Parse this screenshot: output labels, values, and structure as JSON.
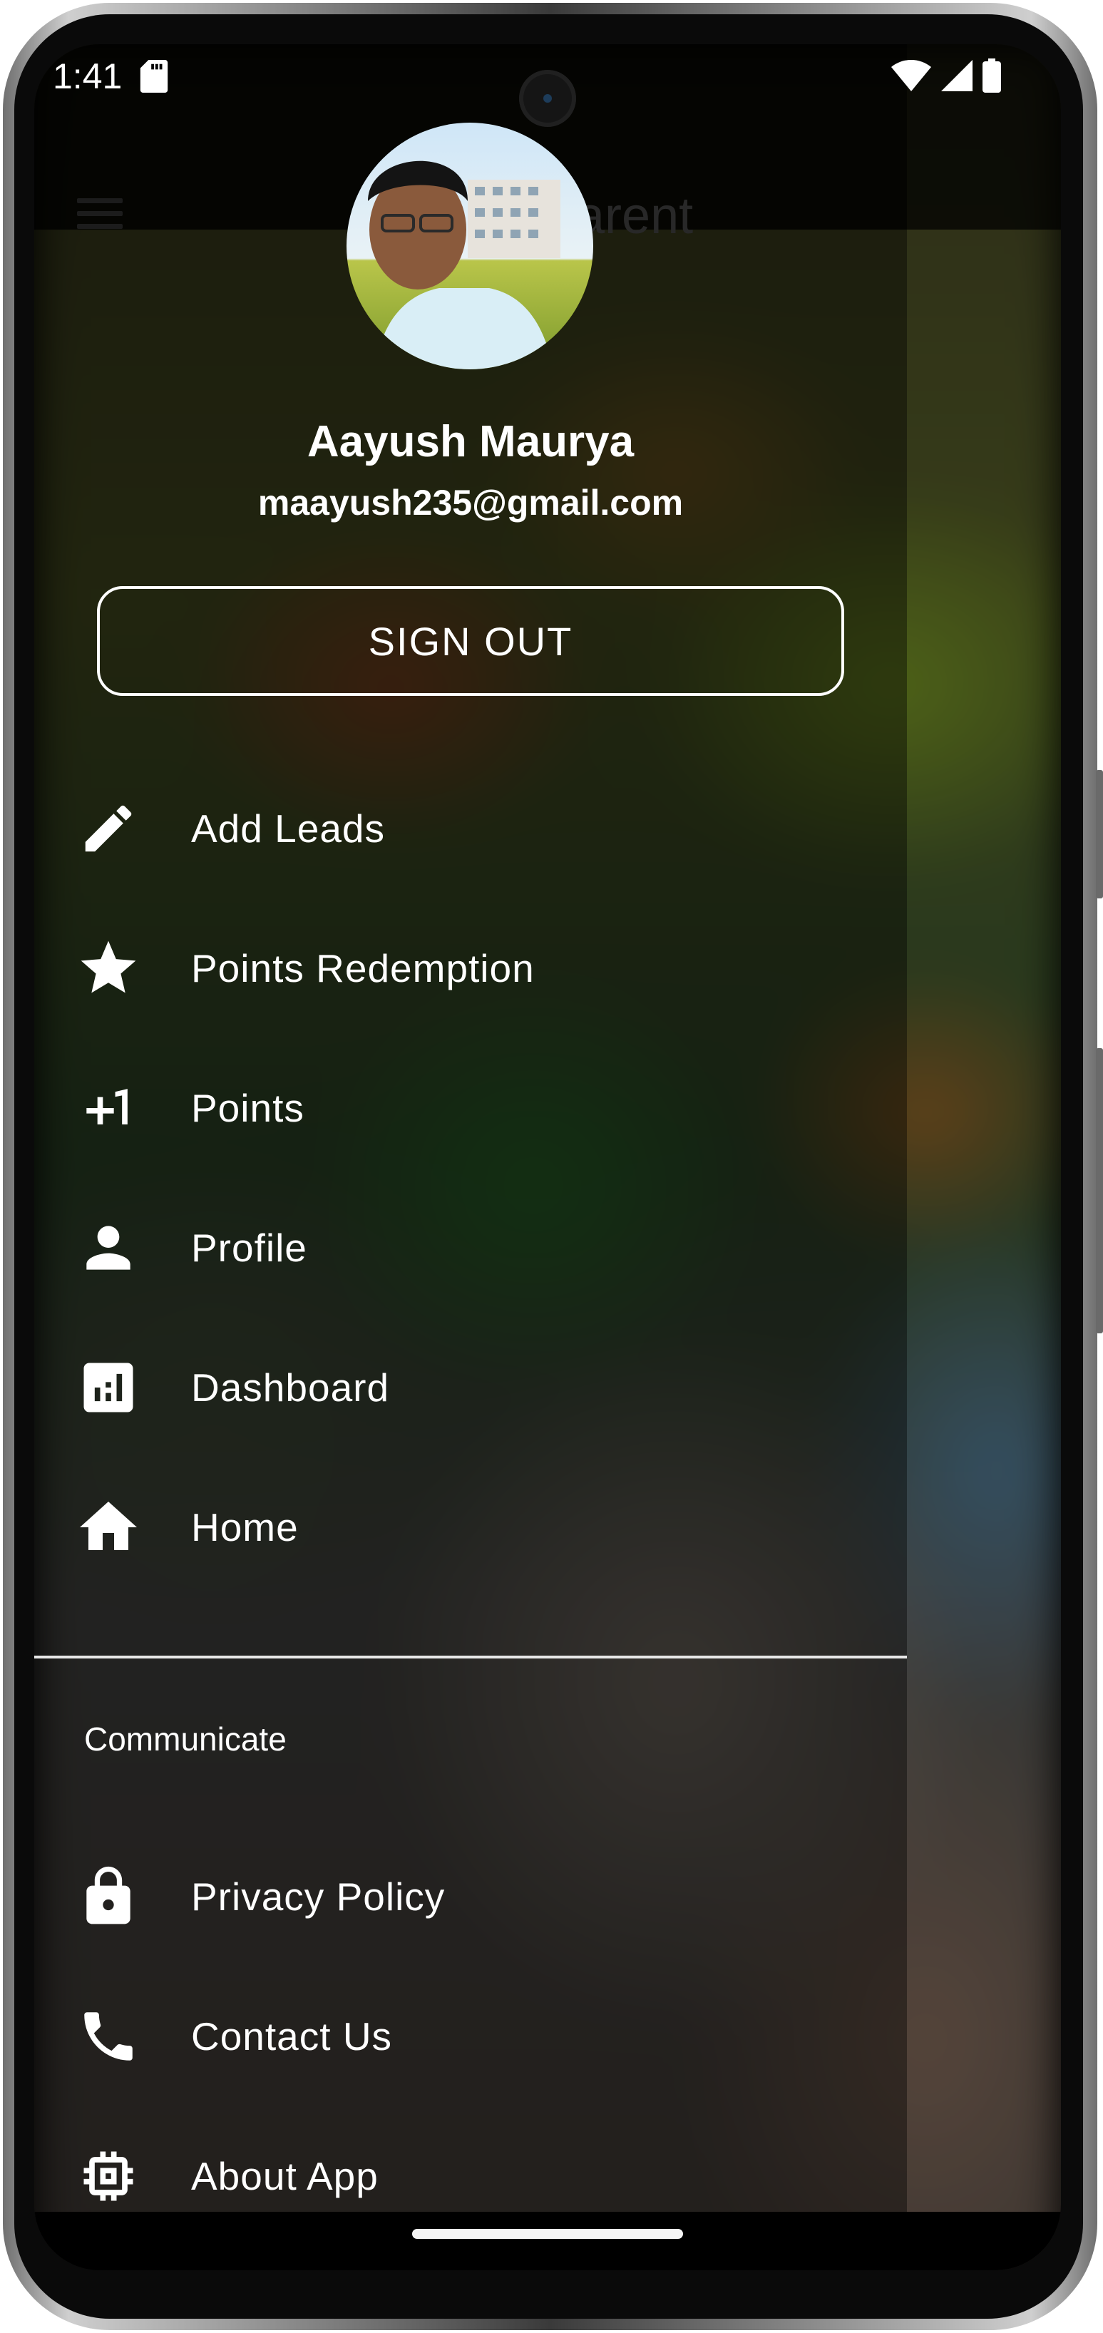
{
  "status_bar": {
    "time": "1:41"
  },
  "app_bar": {
    "title": "arent"
  },
  "user": {
    "name": "Aayush Maurya",
    "email": "maayush235@gmail.com"
  },
  "sign_out_label": "SIGN OUT",
  "menu_items": [
    {
      "label": "Add Leads",
      "icon": "pencil-icon"
    },
    {
      "label": "Points Redemption",
      "icon": "star-icon"
    },
    {
      "label": "Points",
      "icon": "plus-one-icon"
    },
    {
      "label": "Profile",
      "icon": "person-icon"
    },
    {
      "label": "Dashboard",
      "icon": "dashboard-icon"
    },
    {
      "label": "Home",
      "icon": "home-icon"
    }
  ],
  "communicate_section": {
    "title": "Communicate",
    "items": [
      {
        "label": "Privacy Policy",
        "icon": "lock-icon"
      },
      {
        "label": "Contact Us",
        "icon": "phone-icon"
      },
      {
        "label": "About App",
        "icon": "chip-icon"
      }
    ]
  },
  "colors": {
    "text": "#ffffff",
    "drawer_overlay": "#000000"
  }
}
